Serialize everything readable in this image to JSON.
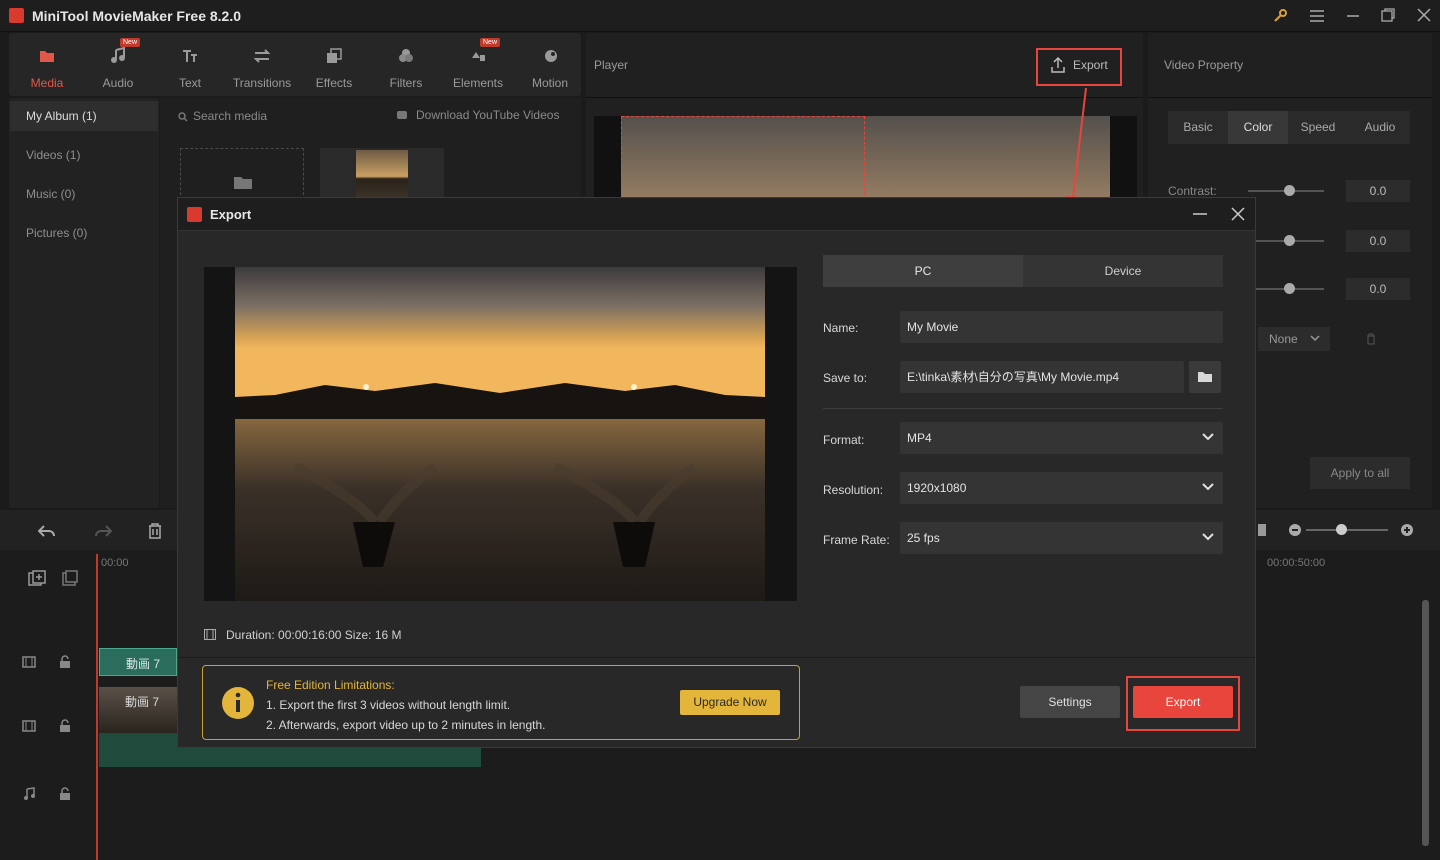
{
  "window": {
    "title": "MiniTool MovieMaker Free 8.2.0"
  },
  "toolbar": {
    "new_badge": "New",
    "tabs": [
      {
        "label": "Media",
        "icon": "media-icon"
      },
      {
        "label": "Audio",
        "icon": "music-note-icon"
      },
      {
        "label": "Text",
        "icon": "text-icon"
      },
      {
        "label": "Transitions",
        "icon": "transitions-icon"
      },
      {
        "label": "Effects",
        "icon": "effects-icon"
      },
      {
        "label": "Filters",
        "icon": "filters-icon"
      },
      {
        "label": "Elements",
        "icon": "elements-icon"
      },
      {
        "label": "Motion",
        "icon": "motion-icon"
      }
    ]
  },
  "library": {
    "albums": [
      "My Album (1)",
      "Videos (1)",
      "Music (0)",
      "Pictures (0)"
    ],
    "search_placeholder": "Search media",
    "download_label": "Download YouTube Videos"
  },
  "player": {
    "title": "Player",
    "export_label": "Export"
  },
  "video_property": {
    "title": "Video Property",
    "tabs": [
      "Basic",
      "Color",
      "Speed",
      "Audio"
    ],
    "contrast_label": "Contrast:",
    "values": [
      "0.0",
      "0.0",
      "0.0"
    ],
    "preset": "None",
    "apply_all": "Apply to all"
  },
  "timeline": {
    "time_start": "00:00",
    "time_end": "00:00:50:00",
    "clip_label": "動画 7"
  },
  "dialog": {
    "title": "Export",
    "tabs": [
      "PC",
      "Device"
    ],
    "name_label": "Name:",
    "name_value": "My Movie",
    "save_label": "Save to:",
    "save_value": "E:\\tinka\\素材\\自分の写真\\My Movie.mp4",
    "format_label": "Format:",
    "format_value": "MP4",
    "resolution_label": "Resolution:",
    "resolution_value": "1920x1080",
    "framerate_label": "Frame Rate:",
    "framerate_value": "25 fps",
    "duration_label": "Duration:",
    "duration_value": "00:00:16:00",
    "size_label": "Size:",
    "size_value": "16 M",
    "limits_title": "Free Edition Limitations:",
    "limits_line1": "1. Export the first 3 videos without length limit.",
    "limits_line2": "2. Afterwards, export video up to 2 minutes in length.",
    "upgrade_label": "Upgrade Now",
    "settings_label": "Settings",
    "export_label": "Export"
  },
  "colors": {
    "accent": "#e8453c",
    "warning": "#e4b53b",
    "panel": "#282828"
  }
}
